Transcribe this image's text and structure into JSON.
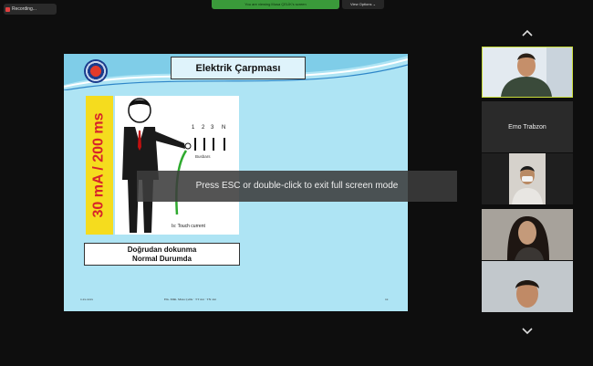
{
  "toolbar": {
    "recording_label": "Recording...",
    "share_banner": "You are viewing Musa ÇELİK's screen",
    "view_options_label": "View Options ⌄"
  },
  "slide": {
    "title": "Elektrik Çarpması",
    "vertical_text": "30 mA / 200 ms",
    "busbar_labels": [
      "1",
      "2",
      "3",
      "N"
    ],
    "busbars_caption": "Busbars",
    "touch_current_label": "Is: Touch current",
    "caption_line1": "Doğrudan dokunma",
    "caption_line2": "Normal Durumda",
    "footer_left": "x.xx.xxxx",
    "footer_mid": "Elk. Müh. Musa Çelik · TT sist · TN sist",
    "footer_right": "xx"
  },
  "overlay": {
    "message": "Press ESC or double-click to exit full screen mode"
  },
  "participants": [
    {
      "name": "",
      "has_video": true
    },
    {
      "name": "Emo Trabzon",
      "has_video": false
    },
    {
      "name": "",
      "has_video": true
    },
    {
      "name": "",
      "has_video": true
    },
    {
      "name": "",
      "has_video": true
    }
  ],
  "colors": {
    "slide_bg": "#aee4f4",
    "vertical_bar": "#f5dc1e",
    "vertical_text": "#d8232a",
    "active_speaker_border": "#c9dd3a",
    "share_banner": "#3a9a3a"
  },
  "icons": {
    "scroll_up": "chevron-up-icon",
    "scroll_down": "chevron-down-icon",
    "recording": "recording-icon"
  }
}
